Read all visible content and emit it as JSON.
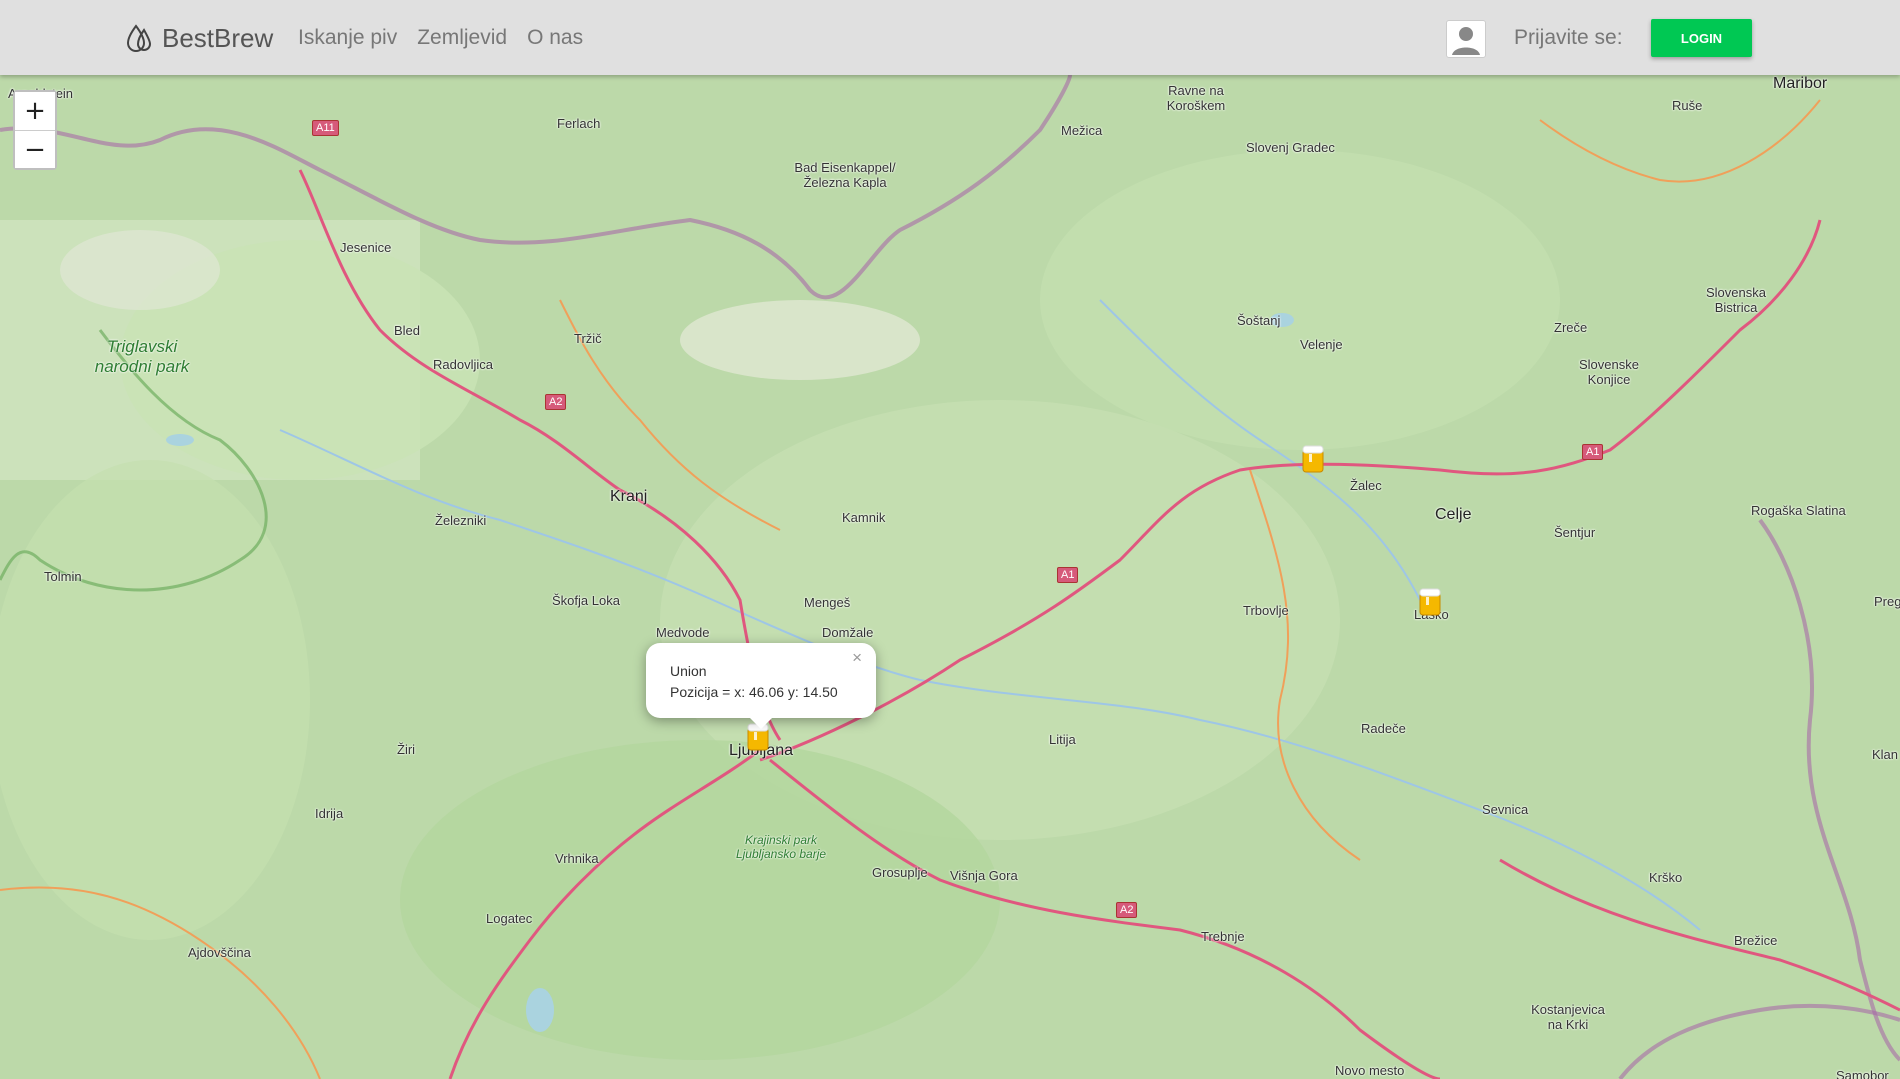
{
  "brand": {
    "name": "BestBrew",
    "icon": "logo-drops-icon"
  },
  "nav": {
    "links": [
      "Iskanje piv",
      "Zemljevid",
      "O nas"
    ]
  },
  "user": {
    "login_label": "Prijavite se:",
    "login_button": "LOGIN",
    "avatar_icon": "user-avatar-icon"
  },
  "zoom": {
    "in": "+",
    "out": "−"
  },
  "popup": {
    "title": "Union",
    "position_text": "Pozicija = x: 46.06 y: 14.50",
    "close": "×"
  },
  "colors": {
    "accent": "#00c853",
    "navbar": "#e0e0e0",
    "marker": "#f5b800",
    "motorway": "#e0577f"
  },
  "map_labels": {
    "ljubljana": "Ljubljana",
    "kranj": "Kranj",
    "celje": "Celje",
    "maribor": "Maribor",
    "jesenice": "Jesenice",
    "bled": "Bled",
    "radovljica": "Radovljica",
    "trzic": "Tržič",
    "ferlach": "Ferlach",
    "bad_eisenkappel": "Bad Eisenkappel/ Železna Kapla",
    "mezica": "Mežica",
    "ravne": "Ravne na Koroškem",
    "slovenj_gradec": "Slovenj Gradec",
    "sostanj": "Šoštanj",
    "velenje": "Velenje",
    "zalec": "Žalec",
    "zrece": "Zreče",
    "slovenske_konjice": "Slovenske Konjice",
    "slovenska_bistrica": "Slovenska Bistrica",
    "ruse": "Ruše",
    "rogaska_slatina": "Rogaška Slatina",
    "sentjur": "Šentjur",
    "kamnik": "Kamnik",
    "menges": "Mengeš",
    "domzale": "Domžale",
    "zelezniki": "Železniki",
    "skofja_loka": "Škofja Loka",
    "medvode": "Medvode",
    "tolmin": "Tolmin",
    "trbovlje": "Trbovlje",
    "lasko": "Laško",
    "radece": "Radeče",
    "litija": "Litija",
    "sevnica": "Sevnica",
    "krsko": "Krško",
    "brezice": "Brežice",
    "ziri": "Žiri",
    "idrija": "Idrija",
    "vrhnika": "Vrhnika",
    "logatec": "Logatec",
    "grosuplje": "Grosuplje",
    "visnja_gora": "Višnja Gora",
    "trebnje": "Trebnje",
    "ajdovscina": "Ajdovščina",
    "kostanjevica": "Kostanjevica na Krki",
    "novo_mesto": "Novo mesto",
    "klan": "Klan",
    "preg": "Preg",
    "samobor": "Samobor",
    "arnoldstein": "Arnoldstein",
    "triglav": "Triglavski narodni park",
    "krajinski": "Krajinski park Ljubljansko barje"
  },
  "road_shields": {
    "a11": "A11",
    "a2_north": "A2",
    "a1_mid": "A1",
    "a1_east": "A1",
    "a2_south": "A2"
  },
  "markers": [
    "beer-marker-icon",
    "beer-marker-icon",
    "beer-marker-icon"
  ]
}
